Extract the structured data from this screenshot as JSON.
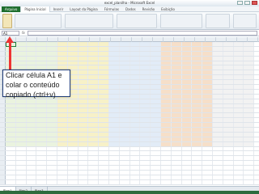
{
  "window": {
    "title": "excel_planilha - Microsoft Excel"
  },
  "ribbon_tabs": [
    "Arquivo",
    "Página Inicial",
    "Inserir",
    "Layout da Página",
    "Fórmulas",
    "Dados",
    "Revisão",
    "Exibição"
  ],
  "name_box": "A1",
  "fx_label": "fx",
  "callout": {
    "line1": "Clicar célula A1 e",
    "line2": "colar o conteúdo",
    "line3": "copiado (ctrl+v)"
  },
  "sheet_tabs": [
    "Plan1",
    "Plan2",
    "Plan3"
  ],
  "colors": {
    "accent": "#1e6e2e",
    "arrow": "#e33333",
    "callout_border": "#1f3c78"
  }
}
